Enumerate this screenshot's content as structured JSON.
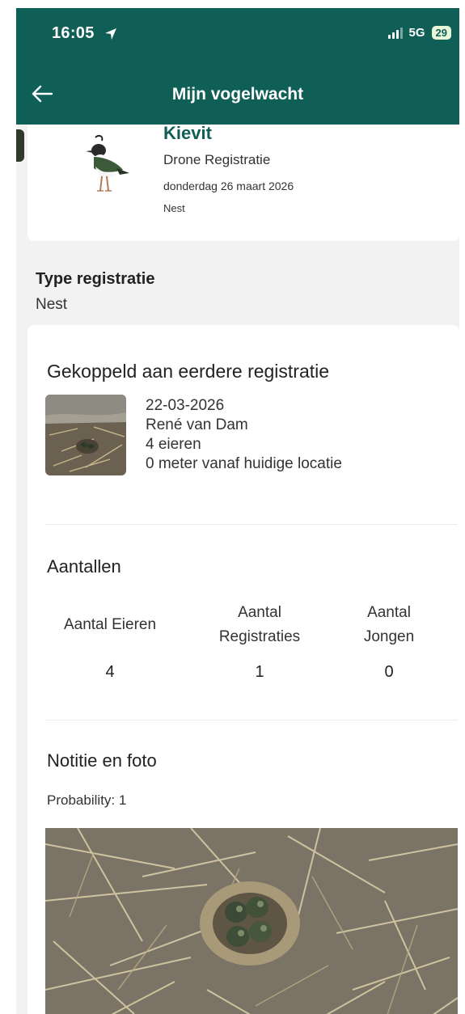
{
  "status_bar": {
    "time": "16:05",
    "network": "5G",
    "battery": "29"
  },
  "app_bar": {
    "title": "Mijn vogelwacht",
    "back_icon": "arrow-left-icon"
  },
  "bird": {
    "name": "Kievit",
    "registration_type": "Drone  Registratie",
    "date": "donderdag 26 maart 2026",
    "kind": "Nest"
  },
  "type_registratie": {
    "label": "Type registratie",
    "value": "Nest"
  },
  "linked": {
    "title": "Gekoppeld aan eerdere registratie",
    "date": "22-03-2026",
    "observer": "René van Dam",
    "eggs": "4 eieren",
    "distance": "0 meter vanaf huidige locatie"
  },
  "counts": {
    "title": "Aantallen",
    "columns": [
      {
        "label": "Aantal Eieren",
        "value": "4"
      },
      {
        "label": "Aantal Registraties",
        "value": "1"
      },
      {
        "label": "Aantal Jongen",
        "value": "0"
      }
    ]
  },
  "note": {
    "title": "Notitie en foto",
    "probability": "Probability: 1"
  },
  "colors": {
    "primary": "#0f5f56",
    "background": "#f2f2f2",
    "card": "#ffffff"
  }
}
